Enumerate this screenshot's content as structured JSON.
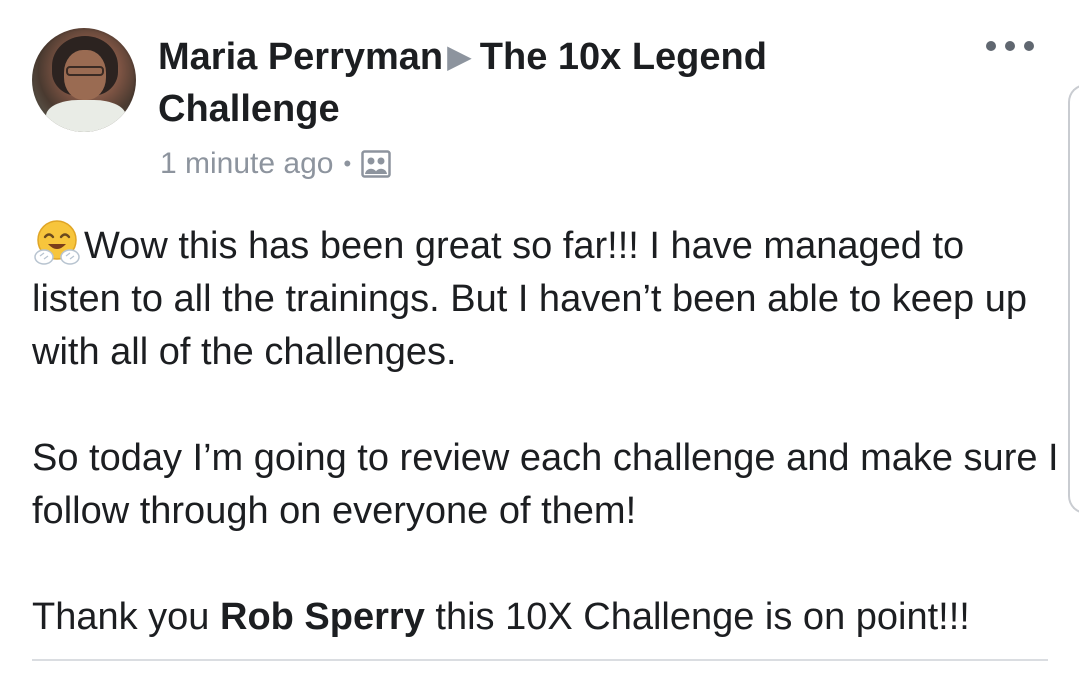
{
  "post": {
    "author": "Maria Perryman",
    "group": "The 10x Legend Challenge",
    "timestamp": "1 minute ago",
    "separator": "•",
    "privacy_icon": "group-icon",
    "avatar_icon": "avatar-photo",
    "more_icon": "more-options-icon",
    "emoji_icon": "hugging-face-emoji",
    "paragraph1": "Wow this has been great so far!!! I have managed to listen to all the trainings. But I haven’t been able to keep up with all of the challenges.",
    "paragraph2": "So today I’m going to review each challenge and make sure I follow through on everyone of them!",
    "paragraph3_pre": "Thank you ",
    "paragraph3_mention": "Rob Sperry",
    "paragraph3_post": " this 10X Challenge is on point!!!"
  },
  "colors": {
    "text": "#1c1e21",
    "meta": "#8d949e",
    "divider": "#dadde1"
  }
}
